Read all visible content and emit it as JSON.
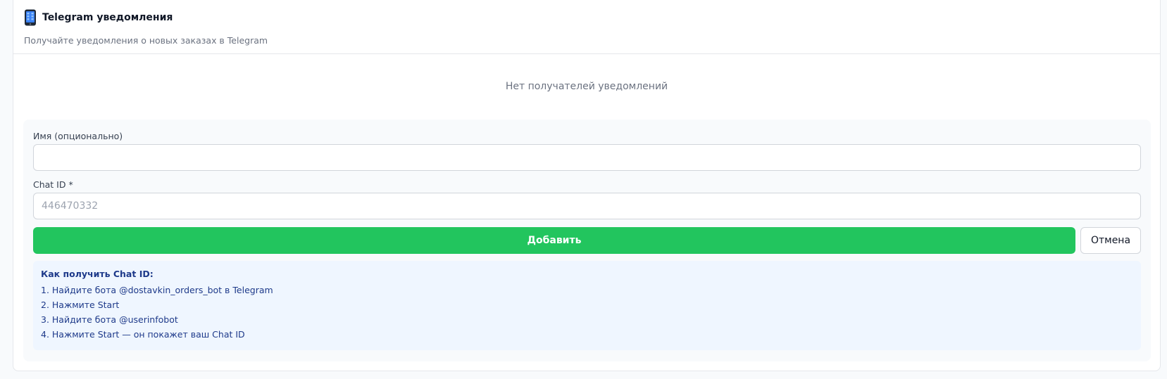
{
  "header": {
    "icon": "mobile-phone-icon",
    "title": "Telegram уведомления",
    "subtitle": "Получайте уведомления о новых заказах в Telegram"
  },
  "empty_state": {
    "text": "Нет получателей уведомлений"
  },
  "form": {
    "name_label": "Имя (опционально)",
    "name_value": "",
    "chat_id_label": "Chat ID *",
    "chat_id_placeholder": "446470332",
    "add_button": "Добавить",
    "cancel_button": "Отмена"
  },
  "info": {
    "title": "Как получить Chat ID:",
    "steps": [
      "1. Найдите бота @dostavkin_orders_bot в Telegram",
      "2. Нажмите Start",
      "3. Найдите бота @userinfobot",
      "4. Нажмите Start — он покажет ваш Chat ID"
    ]
  },
  "colors": {
    "primary_button": "#22c55e",
    "info_background": "#eff6ff",
    "info_text": "#1e3a8a"
  }
}
